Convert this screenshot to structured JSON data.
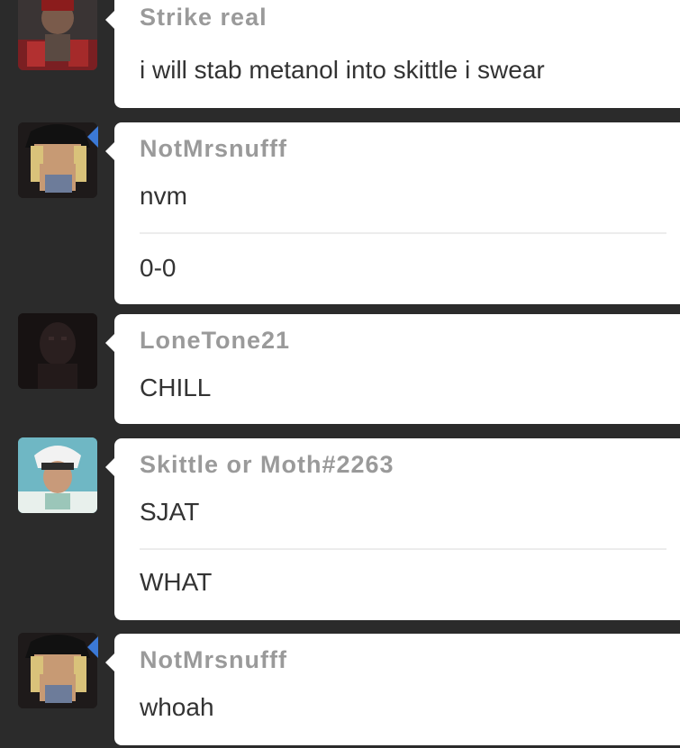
{
  "messages": [
    {
      "username": "Strike real",
      "lines": [
        "i will stab metanol into skittle i swear"
      ]
    },
    {
      "username": "NotMrsnufff",
      "lines": [
        "nvm",
        "0-0"
      ]
    },
    {
      "username": "LoneTone21",
      "lines": [
        "CHILL"
      ]
    },
    {
      "username": "Skittle or Moth#2263",
      "lines": [
        "SJAT",
        "WHAT"
      ]
    },
    {
      "username": "NotMrsnufff",
      "lines": [
        "whoah"
      ]
    }
  ],
  "colors": {
    "background": "#2b2b2b",
    "bubble": "#ffffff",
    "username": "#9a9a9a",
    "message_text": "#333333",
    "accent": "#3b79d6"
  }
}
